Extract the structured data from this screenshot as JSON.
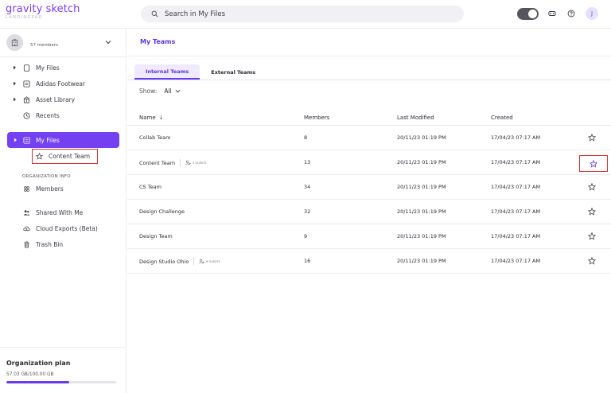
{
  "header": {
    "logo_name": "gravity sketch",
    "logo_sub": "LANDINGPAD",
    "search_placeholder": "Search in My Files",
    "avatar_initial": "J"
  },
  "sidebar": {
    "org_members": "57 members",
    "items_top": [
      {
        "label": "My Files",
        "icon": "file-icon"
      },
      {
        "label": "Adidas Footwear",
        "icon": "folder-icon"
      },
      {
        "label": "Asset Library",
        "icon": "library-icon"
      },
      {
        "label": "Recents",
        "icon": "clock-icon"
      }
    ],
    "active_item": "My Files",
    "sub_item": "Content Team",
    "section_title": "ORGANIZATION INFO",
    "members_label": "Members",
    "items_bottom": [
      {
        "label": "Shared With Me",
        "icon": "shared-icon"
      },
      {
        "label": "Cloud Exports (Beta)",
        "icon": "cloud-icon"
      },
      {
        "label": "Trash Bin",
        "icon": "trash-icon"
      }
    ],
    "plan": {
      "title": "Organization plan",
      "usage": "57.03 GB/100.00 GB",
      "fraction": 0.5703
    }
  },
  "main": {
    "breadcrumb": "My Teams",
    "tabs": [
      "Internal Teams",
      "External Teams"
    ],
    "show_label": "Show:",
    "show_value": "All",
    "columns": {
      "name": "Name",
      "members": "Members",
      "modified": "Last Modified",
      "created": "Created"
    },
    "rows": [
      {
        "name": "Collab Team",
        "guests": "",
        "members": "8",
        "modified": "20/11/23 01:19 PM",
        "created": "17/04/23 07:17 AM"
      },
      {
        "name": "Content Team",
        "guests": "3 GUESTS",
        "members": "13",
        "modified": "20/11/23 01:19 PM",
        "created": "17/04/23 07:17 AM"
      },
      {
        "name": "CS Team",
        "guests": "",
        "members": "34",
        "modified": "20/11/23 01:19 PM",
        "created": "17/04/23 07:17 AM"
      },
      {
        "name": "Design Challenge",
        "guests": "",
        "members": "32",
        "modified": "20/11/23 01:19 PM",
        "created": "17/04/23 07:17 AM"
      },
      {
        "name": "Design Team",
        "guests": "",
        "members": "9",
        "modified": "20/11/23 01:19 PM",
        "created": "17/04/23 07:17 AM"
      },
      {
        "name": "Design Studio Ohio",
        "guests": "6 GUESTS",
        "members": "16",
        "modified": "20/11/23 01:19 PM",
        "created": "17/04/23 07:17 AM"
      }
    ]
  },
  "colors": {
    "accent": "#7340f2",
    "highlight_box": "#d63232"
  }
}
